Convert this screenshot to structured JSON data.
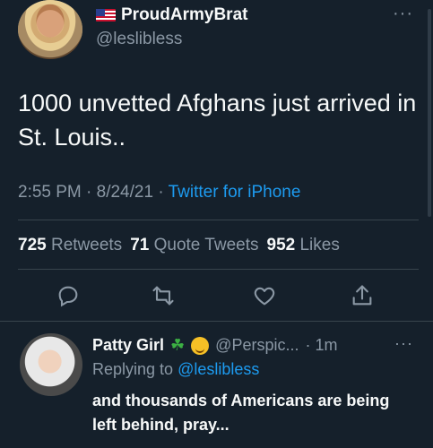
{
  "tweet": {
    "display_name": "ProudArmyBrat",
    "handle": "@leslibless",
    "text": "1000 unvetted Afghans just arrived in St. Louis..",
    "timestamp": "2:55 PM · 8/24/21 · ",
    "source": "Twitter for iPhone",
    "more": "···",
    "flag_icon": "us-flag-icon"
  },
  "stats": {
    "retweets_count": "725",
    "retweets_label": "Retweets",
    "quote_count": "71",
    "quote_label": "Quote Tweets",
    "likes_count": "952",
    "likes_label": "Likes"
  },
  "actions": {
    "icons": [
      "reply-icon",
      "retweet-icon",
      "like-icon",
      "share-icon"
    ]
  },
  "reply": {
    "display_name": "Patty Girl",
    "handle": "@Perspic...",
    "time": "· 1m",
    "more": "···",
    "replying_prefix": "Replying to",
    "replying_to": "@leslibless",
    "text": "and thousands of Americans are being left behind, pray...",
    "emoji_clover": "☘",
    "emoji_face": "wink-face-icon"
  },
  "colors": {
    "background": "#15202b",
    "primary_text": "#f7f9f9",
    "secondary_text": "#8b98a5",
    "accent": "#1d9bf0",
    "divider": "#38444d"
  }
}
